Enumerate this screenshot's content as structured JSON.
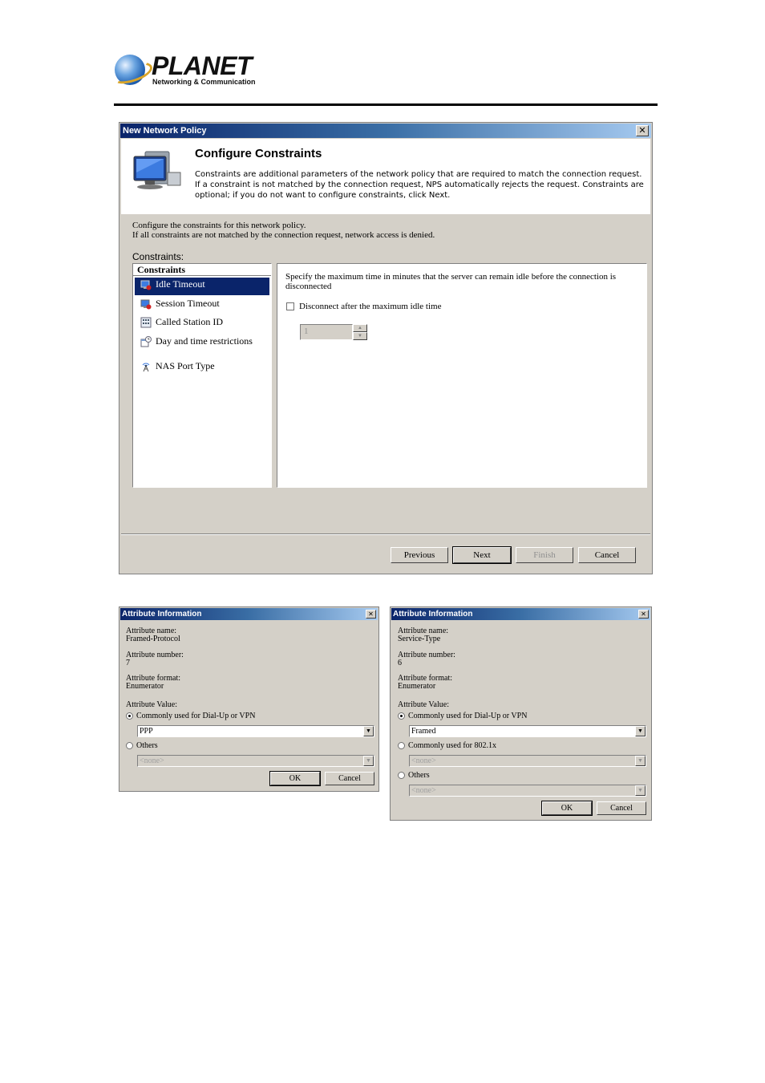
{
  "brand": {
    "name": "PLANET",
    "tagline": "Networking & Communication"
  },
  "wizard": {
    "title": "New Network Policy",
    "heading": "Configure Constraints",
    "description": "Constraints are additional parameters of the network policy that are required to match the connection request. If a constraint is not matched by the connection request, NPS automatically rejects the request. Constraints are optional; if you do not want to configure constraints, click Next.",
    "intro_line1": "Configure the constraints for this network policy.",
    "intro_line2": "If all constraints are not matched by the connection request, network access is denied.",
    "constraints_label": "Constraints:",
    "list_header": "Constraints",
    "items": [
      {
        "label": "Idle Timeout",
        "icon": "idle-timeout-icon"
      },
      {
        "label": "Session Timeout",
        "icon": "session-timeout-icon"
      },
      {
        "label": "Called Station ID",
        "icon": "called-station-icon"
      },
      {
        "label": "Day and time restrictions",
        "icon": "calendar-clock-icon"
      },
      {
        "label": "NAS Port Type",
        "icon": "antenna-icon"
      }
    ],
    "selected_index": 0,
    "panel_description": "Specify the maximum time in minutes that the server can remain idle before the connection is disconnected",
    "checkbox_label": "Disconnect after the maximum idle time",
    "checkbox_checked": false,
    "spin_value": "1",
    "buttons": {
      "previous": "Previous",
      "next": "Next",
      "finish": "Finish",
      "cancel": "Cancel"
    }
  },
  "attr_dialog_1": {
    "title": "Attribute Information",
    "name_label": "Attribute name:",
    "name_value": "Framed-Protocol",
    "number_label": "Attribute number:",
    "number_value": "7",
    "format_label": "Attribute format:",
    "format_value": "Enumerator",
    "value_label": "Attribute Value:",
    "option_common": "Commonly used for Dial-Up or VPN",
    "common_value": "PPP",
    "option_others": "Others",
    "others_value": "<none>",
    "ok": "OK",
    "cancel": "Cancel"
  },
  "attr_dialog_2": {
    "title": "Attribute Information",
    "name_label": "Attribute name:",
    "name_value": "Service-Type",
    "number_label": "Attribute number:",
    "number_value": "6",
    "format_label": "Attribute format:",
    "format_value": "Enumerator",
    "value_label": "Attribute Value:",
    "option_common": "Commonly used for Dial-Up or VPN",
    "common_value": "Framed",
    "option_8021x": "Commonly used for 802.1x",
    "value_8021x": "<none>",
    "option_others": "Others",
    "others_value": "<none>",
    "ok": "OK",
    "cancel": "Cancel"
  },
  "colors": {
    "titlebar_start": "#0a246a",
    "titlebar_end": "#a6caf0",
    "dialog_face": "#d4d0c8",
    "selection": "#0a246a"
  }
}
